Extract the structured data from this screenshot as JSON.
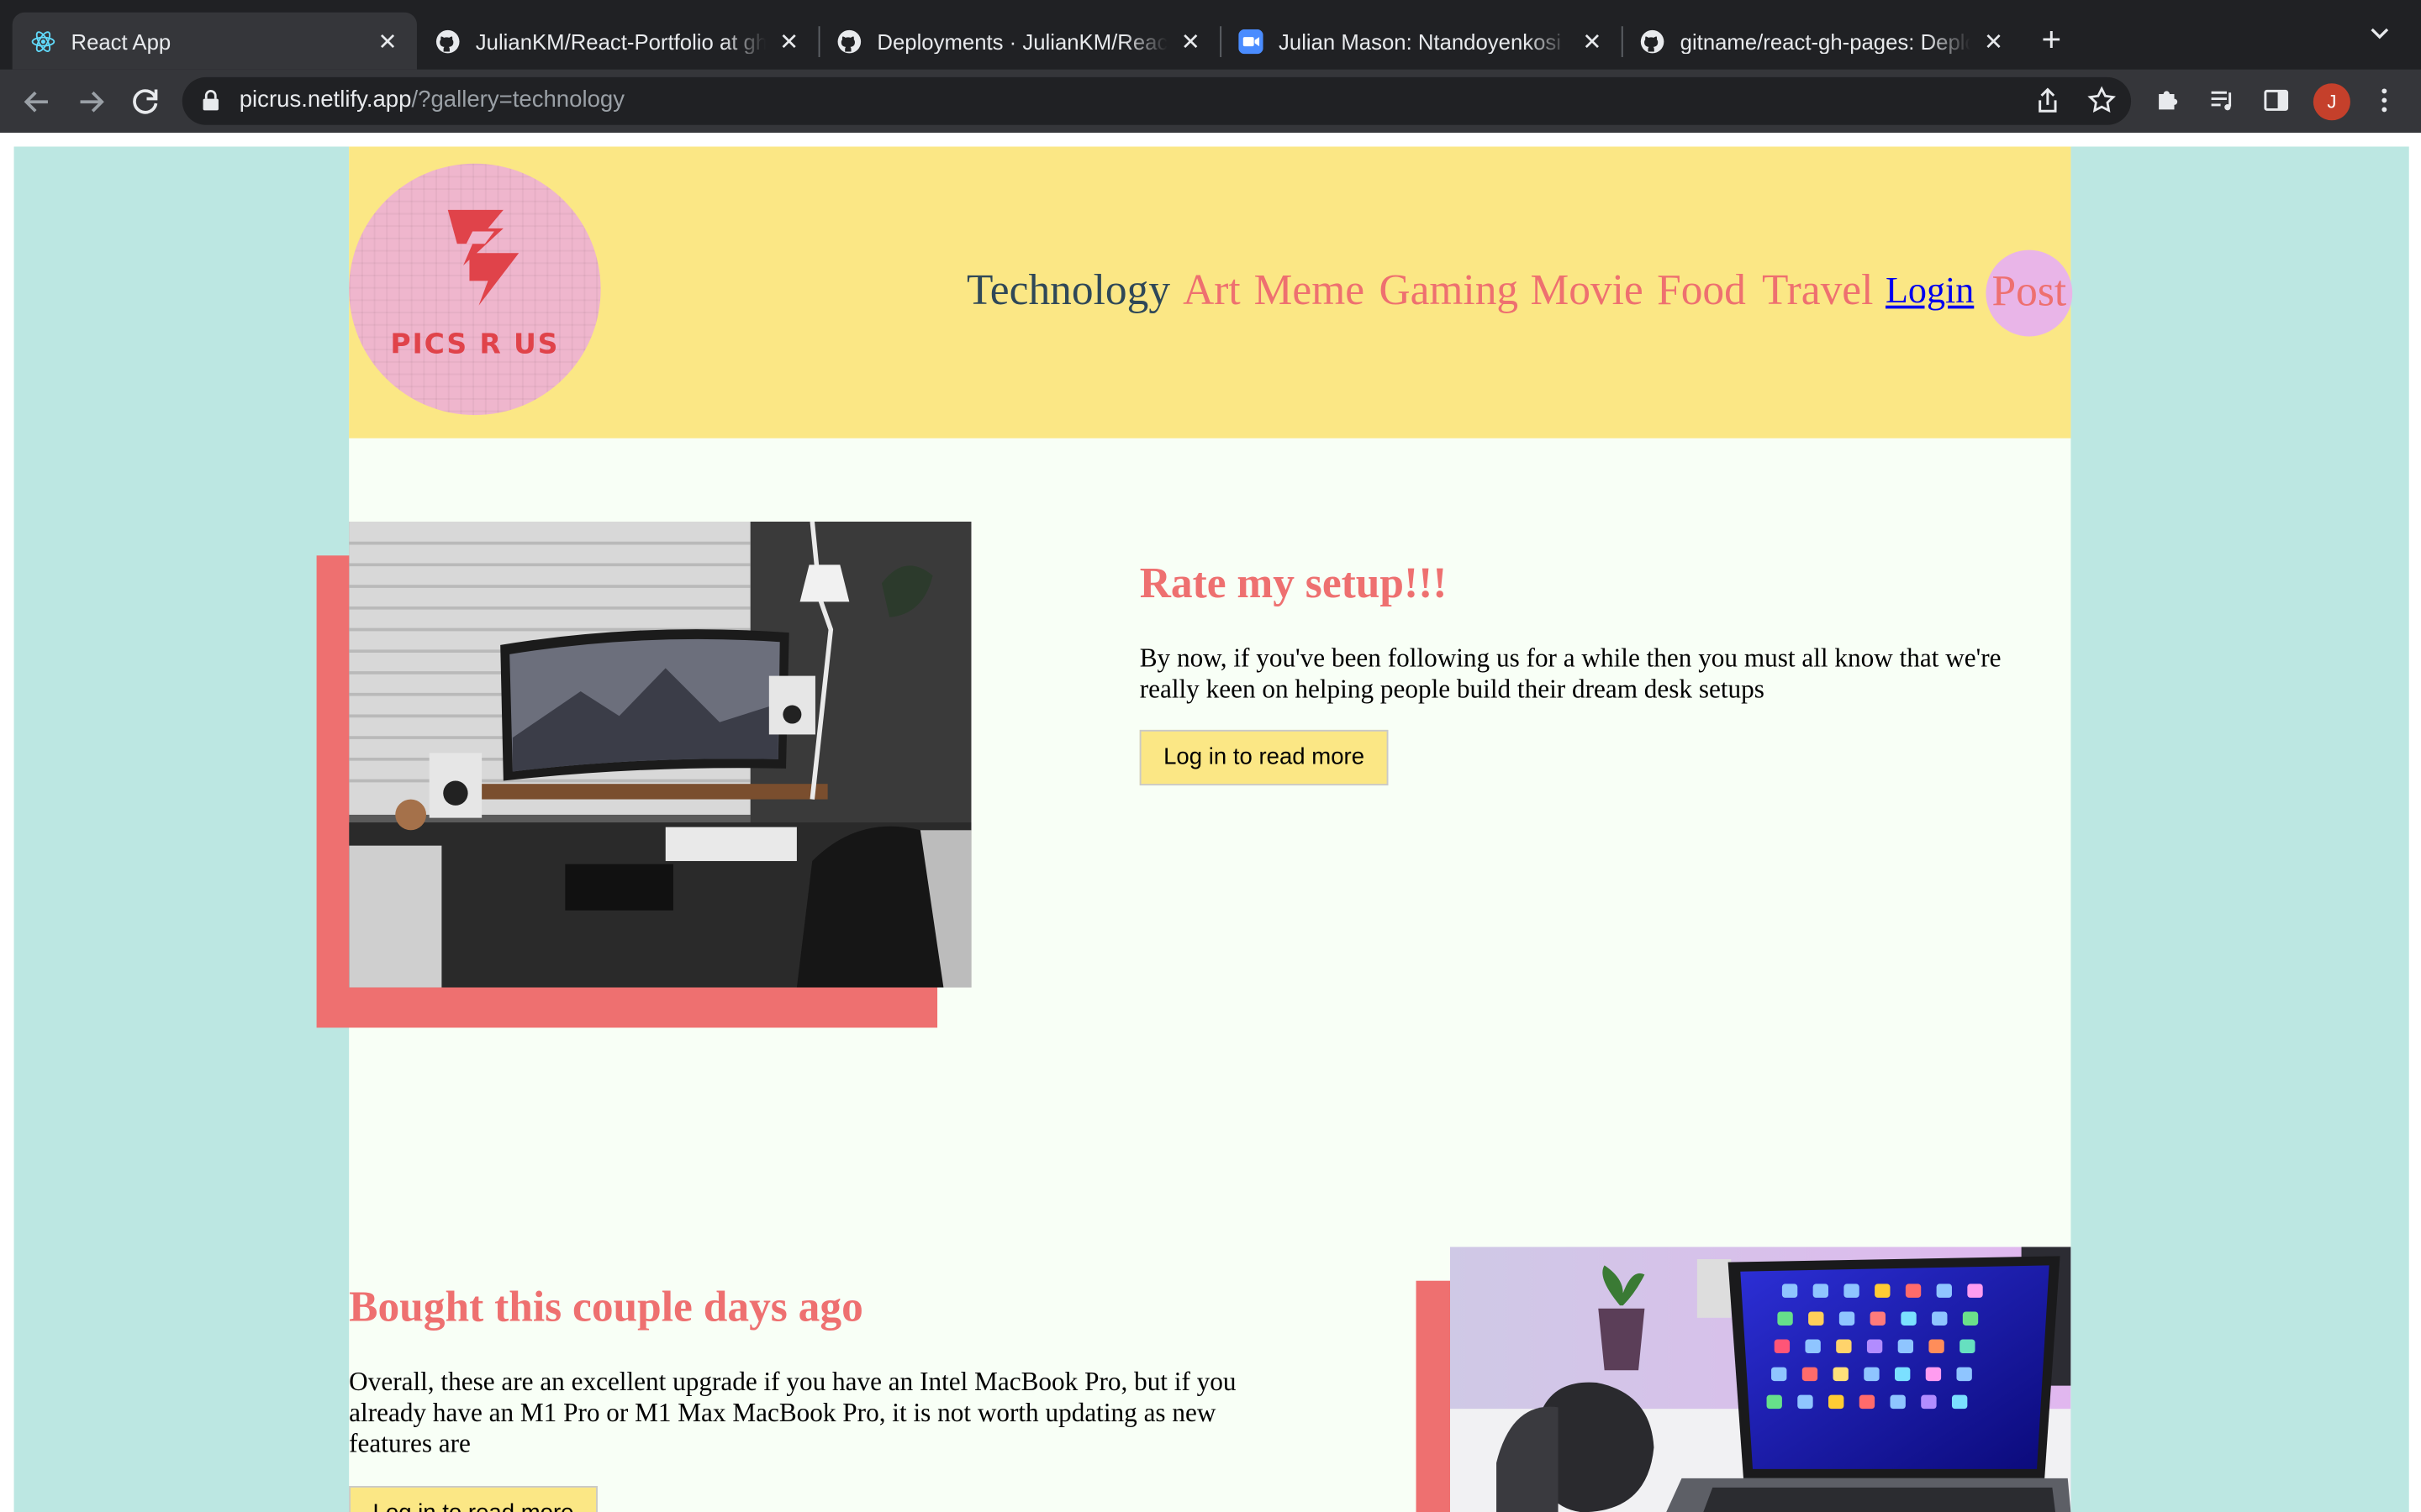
{
  "browser": {
    "tabs": [
      {
        "title": "React App",
        "favicon": "react-icon",
        "active": true
      },
      {
        "title": "JulianKM/React-Portfolio at gh",
        "favicon": "github-icon",
        "active": false
      },
      {
        "title": "Deployments · JulianKM/React",
        "favicon": "github-icon",
        "active": false
      },
      {
        "title": "Julian Mason: Ntandoyenkosi M",
        "favicon": "zoom-icon",
        "active": false
      },
      {
        "title": "gitname/react-gh-pages: Deplo",
        "favicon": "github-icon",
        "active": false
      }
    ],
    "new_tab": "+",
    "tab_list_icon": "chevron-down-icon",
    "address": {
      "host": "picrus.netlify.app",
      "path": "/?gallery=technology"
    },
    "avatar_letter": "J"
  },
  "site": {
    "logo_text": "PICS R US",
    "nav": {
      "items": [
        "Technology",
        "Art",
        "Meme",
        "Gaming",
        "Movie",
        "Food",
        "Travel"
      ],
      "active": "Technology",
      "login": "Login",
      "post": "Post"
    },
    "colors": {
      "header": "#fbe785",
      "accent": "#ee7070",
      "page": "#f8fff6",
      "side": "#bce7e2",
      "active_nav": "#2f4858"
    }
  },
  "posts": [
    {
      "title": "Rate my setup!!!",
      "body": "By now, if you've been following us for a while then you must all know that we're really keen on helping people build their dream desk setups",
      "button": "Log in to read more",
      "image": "desk-setup-photo"
    },
    {
      "title": "Bought this couple days ago",
      "body": "Overall, these are an excellent upgrade if you have an Intel MacBook Pro, but if you already have an M1 Pro or M1 Max MacBook Pro, it is not worth updating as new features are",
      "button": "Log in to read more",
      "image": "macbook-photo"
    }
  ]
}
